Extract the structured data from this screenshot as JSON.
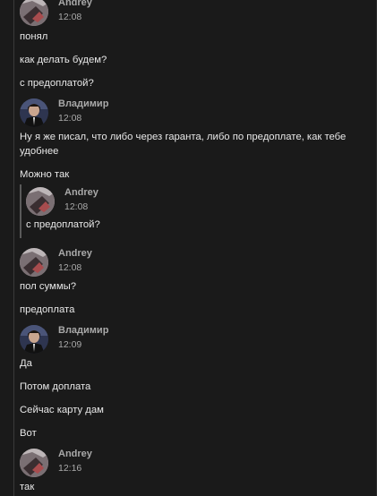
{
  "messages": [
    {
      "author": "Andrey",
      "time": "12:08"
    },
    {
      "text": "понял"
    },
    {
      "text": "как делать будем?"
    },
    {
      "text": "с предоплатой?"
    },
    {
      "author": "Владимир",
      "time": "12:08"
    },
    {
      "text": "Ну я же писал, что либо через гаранта, либо по предоплате, как тебе удобнее"
    },
    {
      "text": "Можно так"
    },
    {
      "quote": {
        "author": "Andrey",
        "time": "12:08",
        "text": "с предоплатой?"
      }
    },
    {
      "author": "Andrey",
      "time": "12:08"
    },
    {
      "text": "пол суммы?"
    },
    {
      "text": "предоплата"
    },
    {
      "author": "Владимир",
      "time": "12:09"
    },
    {
      "text": "Да"
    },
    {
      "text": "Потом доплата"
    },
    {
      "text": "Сейчас карту дам"
    },
    {
      "text": "Вот"
    },
    {
      "author": "Andrey",
      "time": "12:16"
    },
    {
      "text": "так"
    }
  ],
  "avatars": {
    "andrey": "hand-photo-avatar",
    "vladimir": "man-in-suit-avatar"
  }
}
